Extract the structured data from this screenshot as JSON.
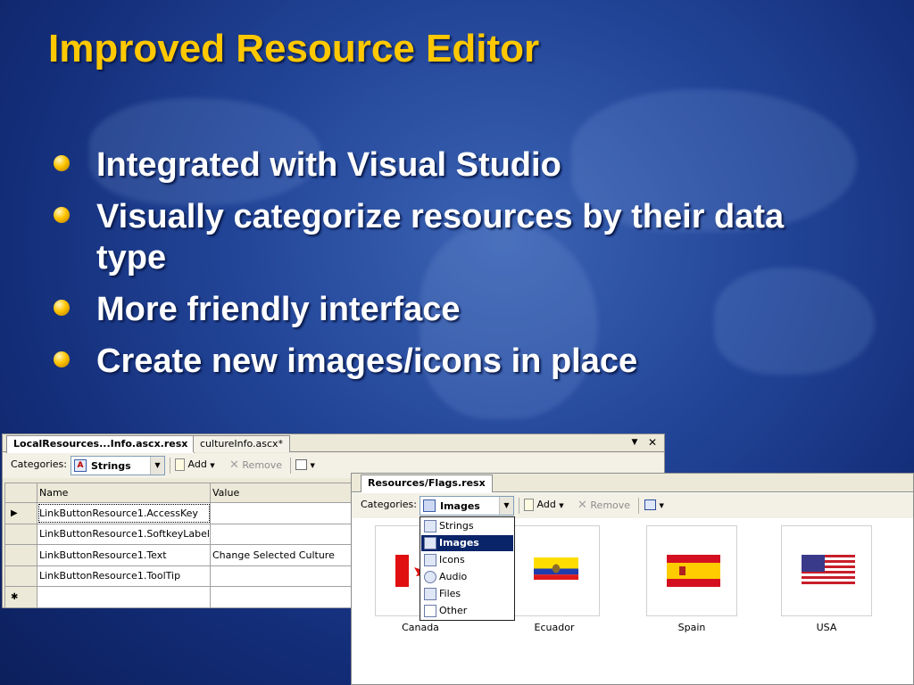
{
  "slide": {
    "title": "Improved Resource Editor",
    "bullets": [
      "Integrated with Visual Studio",
      "Visually categorize resources by their data type",
      "More friendly interface",
      "Create new images/icons in place"
    ]
  },
  "editor1": {
    "tabs": [
      "LocalResources...Info.ascx.resx",
      "cultureInfo.ascx*"
    ],
    "pin_glyph": "▼",
    "close_glyph": "✕",
    "categories_label": "Categories:",
    "category_value": "Strings",
    "add_label": "Add",
    "remove_label": "Remove",
    "columns": [
      "Name",
      "Value"
    ],
    "rows": [
      {
        "marker": "▶",
        "name": "LinkButtonResource1.AccessKey",
        "value": ""
      },
      {
        "marker": "",
        "name": "LinkButtonResource1.SoftkeyLabel",
        "value": ""
      },
      {
        "marker": "",
        "name": "LinkButtonResource1.Text",
        "value": "Change Selected Culture"
      },
      {
        "marker": "",
        "name": "LinkButtonResource1.ToolTip",
        "value": ""
      },
      {
        "marker": "✱",
        "name": "",
        "value": ""
      }
    ]
  },
  "editor2": {
    "tab": "Resources/Flags.resx",
    "categories_label": "Categories:",
    "category_value": "Images",
    "add_label": "Add",
    "remove_label": "Remove",
    "dropdown": {
      "items": [
        "Strings",
        "Images",
        "Icons",
        "Audio",
        "Files",
        "Other"
      ],
      "selected": "Images"
    },
    "images": [
      {
        "label": "Canada",
        "icon": "canada-flag-icon"
      },
      {
        "label": "Ecuador",
        "icon": "ecuador-flag-icon"
      },
      {
        "label": "Spain",
        "icon": "spain-flag-icon"
      },
      {
        "label": "USA",
        "icon": "usa-flag-icon"
      }
    ]
  }
}
